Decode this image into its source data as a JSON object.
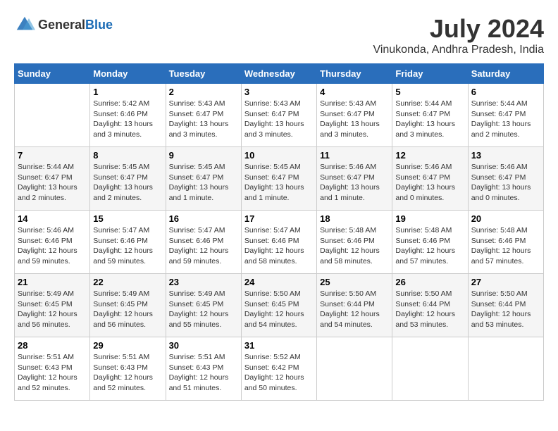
{
  "header": {
    "logo": {
      "general": "General",
      "blue": "Blue"
    },
    "title": "July 2024",
    "location": "Vinukonda, Andhra Pradesh, India"
  },
  "weekdays": [
    "Sunday",
    "Monday",
    "Tuesday",
    "Wednesday",
    "Thursday",
    "Friday",
    "Saturday"
  ],
  "weeks": [
    [
      {
        "day": "",
        "sunrise": "",
        "sunset": "",
        "daylight": ""
      },
      {
        "day": "1",
        "sunrise": "Sunrise: 5:42 AM",
        "sunset": "Sunset: 6:46 PM",
        "daylight": "Daylight: 13 hours and 3 minutes."
      },
      {
        "day": "2",
        "sunrise": "Sunrise: 5:43 AM",
        "sunset": "Sunset: 6:47 PM",
        "daylight": "Daylight: 13 hours and 3 minutes."
      },
      {
        "day": "3",
        "sunrise": "Sunrise: 5:43 AM",
        "sunset": "Sunset: 6:47 PM",
        "daylight": "Daylight: 13 hours and 3 minutes."
      },
      {
        "day": "4",
        "sunrise": "Sunrise: 5:43 AM",
        "sunset": "Sunset: 6:47 PM",
        "daylight": "Daylight: 13 hours and 3 minutes."
      },
      {
        "day": "5",
        "sunrise": "Sunrise: 5:44 AM",
        "sunset": "Sunset: 6:47 PM",
        "daylight": "Daylight: 13 hours and 3 minutes."
      },
      {
        "day": "6",
        "sunrise": "Sunrise: 5:44 AM",
        "sunset": "Sunset: 6:47 PM",
        "daylight": "Daylight: 13 hours and 2 minutes."
      }
    ],
    [
      {
        "day": "7",
        "sunrise": "Sunrise: 5:44 AM",
        "sunset": "Sunset: 6:47 PM",
        "daylight": "Daylight: 13 hours and 2 minutes."
      },
      {
        "day": "8",
        "sunrise": "Sunrise: 5:45 AM",
        "sunset": "Sunset: 6:47 PM",
        "daylight": "Daylight: 13 hours and 2 minutes."
      },
      {
        "day": "9",
        "sunrise": "Sunrise: 5:45 AM",
        "sunset": "Sunset: 6:47 PM",
        "daylight": "Daylight: 13 hours and 1 minute."
      },
      {
        "day": "10",
        "sunrise": "Sunrise: 5:45 AM",
        "sunset": "Sunset: 6:47 PM",
        "daylight": "Daylight: 13 hours and 1 minute."
      },
      {
        "day": "11",
        "sunrise": "Sunrise: 5:46 AM",
        "sunset": "Sunset: 6:47 PM",
        "daylight": "Daylight: 13 hours and 1 minute."
      },
      {
        "day": "12",
        "sunrise": "Sunrise: 5:46 AM",
        "sunset": "Sunset: 6:47 PM",
        "daylight": "Daylight: 13 hours and 0 minutes."
      },
      {
        "day": "13",
        "sunrise": "Sunrise: 5:46 AM",
        "sunset": "Sunset: 6:47 PM",
        "daylight": "Daylight: 13 hours and 0 minutes."
      }
    ],
    [
      {
        "day": "14",
        "sunrise": "Sunrise: 5:46 AM",
        "sunset": "Sunset: 6:46 PM",
        "daylight": "Daylight: 12 hours and 59 minutes."
      },
      {
        "day": "15",
        "sunrise": "Sunrise: 5:47 AM",
        "sunset": "Sunset: 6:46 PM",
        "daylight": "Daylight: 12 hours and 59 minutes."
      },
      {
        "day": "16",
        "sunrise": "Sunrise: 5:47 AM",
        "sunset": "Sunset: 6:46 PM",
        "daylight": "Daylight: 12 hours and 59 minutes."
      },
      {
        "day": "17",
        "sunrise": "Sunrise: 5:47 AM",
        "sunset": "Sunset: 6:46 PM",
        "daylight": "Daylight: 12 hours and 58 minutes."
      },
      {
        "day": "18",
        "sunrise": "Sunrise: 5:48 AM",
        "sunset": "Sunset: 6:46 PM",
        "daylight": "Daylight: 12 hours and 58 minutes."
      },
      {
        "day": "19",
        "sunrise": "Sunrise: 5:48 AM",
        "sunset": "Sunset: 6:46 PM",
        "daylight": "Daylight: 12 hours and 57 minutes."
      },
      {
        "day": "20",
        "sunrise": "Sunrise: 5:48 AM",
        "sunset": "Sunset: 6:46 PM",
        "daylight": "Daylight: 12 hours and 57 minutes."
      }
    ],
    [
      {
        "day": "21",
        "sunrise": "Sunrise: 5:49 AM",
        "sunset": "Sunset: 6:45 PM",
        "daylight": "Daylight: 12 hours and 56 minutes."
      },
      {
        "day": "22",
        "sunrise": "Sunrise: 5:49 AM",
        "sunset": "Sunset: 6:45 PM",
        "daylight": "Daylight: 12 hours and 56 minutes."
      },
      {
        "day": "23",
        "sunrise": "Sunrise: 5:49 AM",
        "sunset": "Sunset: 6:45 PM",
        "daylight": "Daylight: 12 hours and 55 minutes."
      },
      {
        "day": "24",
        "sunrise": "Sunrise: 5:50 AM",
        "sunset": "Sunset: 6:45 PM",
        "daylight": "Daylight: 12 hours and 54 minutes."
      },
      {
        "day": "25",
        "sunrise": "Sunrise: 5:50 AM",
        "sunset": "Sunset: 6:44 PM",
        "daylight": "Daylight: 12 hours and 54 minutes."
      },
      {
        "day": "26",
        "sunrise": "Sunrise: 5:50 AM",
        "sunset": "Sunset: 6:44 PM",
        "daylight": "Daylight: 12 hours and 53 minutes."
      },
      {
        "day": "27",
        "sunrise": "Sunrise: 5:50 AM",
        "sunset": "Sunset: 6:44 PM",
        "daylight": "Daylight: 12 hours and 53 minutes."
      }
    ],
    [
      {
        "day": "28",
        "sunrise": "Sunrise: 5:51 AM",
        "sunset": "Sunset: 6:43 PM",
        "daylight": "Daylight: 12 hours and 52 minutes."
      },
      {
        "day": "29",
        "sunrise": "Sunrise: 5:51 AM",
        "sunset": "Sunset: 6:43 PM",
        "daylight": "Daylight: 12 hours and 52 minutes."
      },
      {
        "day": "30",
        "sunrise": "Sunrise: 5:51 AM",
        "sunset": "Sunset: 6:43 PM",
        "daylight": "Daylight: 12 hours and 51 minutes."
      },
      {
        "day": "31",
        "sunrise": "Sunrise: 5:52 AM",
        "sunset": "Sunset: 6:42 PM",
        "daylight": "Daylight: 12 hours and 50 minutes."
      },
      {
        "day": "",
        "sunrise": "",
        "sunset": "",
        "daylight": ""
      },
      {
        "day": "",
        "sunrise": "",
        "sunset": "",
        "daylight": ""
      },
      {
        "day": "",
        "sunrise": "",
        "sunset": "",
        "daylight": ""
      }
    ]
  ]
}
